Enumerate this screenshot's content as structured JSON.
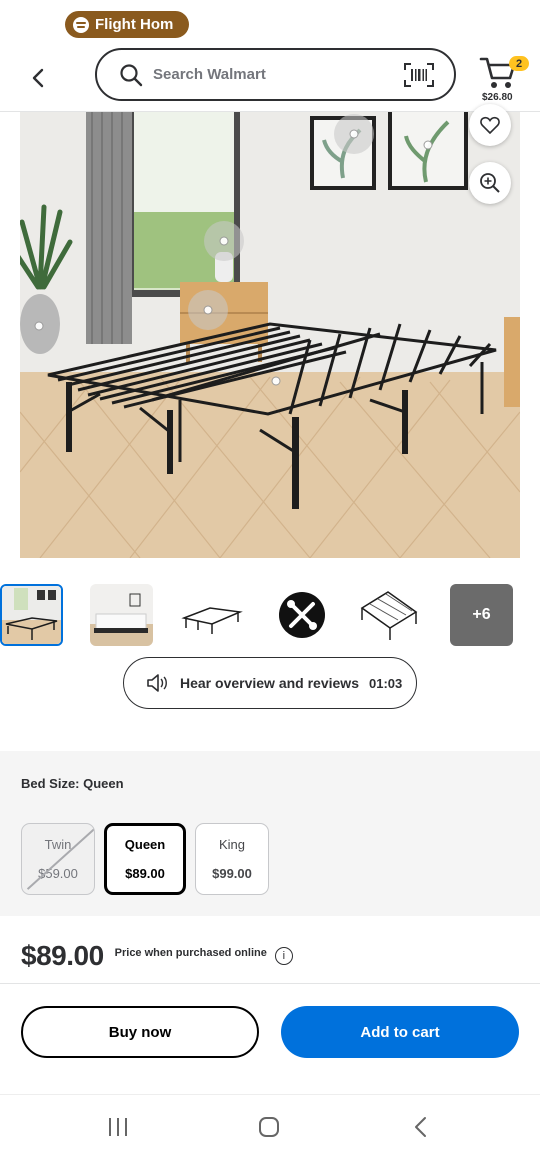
{
  "status_bar": {
    "media_pill_label": "Flight Hom"
  },
  "header": {
    "search_placeholder": "Search Walmart",
    "cart_count": "2",
    "cart_total": "$26.80"
  },
  "product": {
    "thumbnails_more_label": "+6",
    "audio": {
      "label": "Hear overview and reviews",
      "duration": "01:03"
    },
    "variant": {
      "label": "Bed Size: Queen",
      "options": [
        {
          "name": "Twin",
          "price": "$59.00",
          "state": "unavailable"
        },
        {
          "name": "Queen",
          "price": "$89.00",
          "state": "selected"
        },
        {
          "name": "King",
          "price": "$99.00",
          "state": "available"
        }
      ]
    },
    "price": "$89.00",
    "price_note": "Price when purchased online",
    "info_icon_glyph": "i"
  },
  "actions": {
    "buy_now": "Buy now",
    "add_to_cart": "Add to cart"
  },
  "colors": {
    "accent_blue": "#0071dc",
    "badge_yellow": "#ffc220",
    "pill_brown": "#8a5a1e"
  }
}
